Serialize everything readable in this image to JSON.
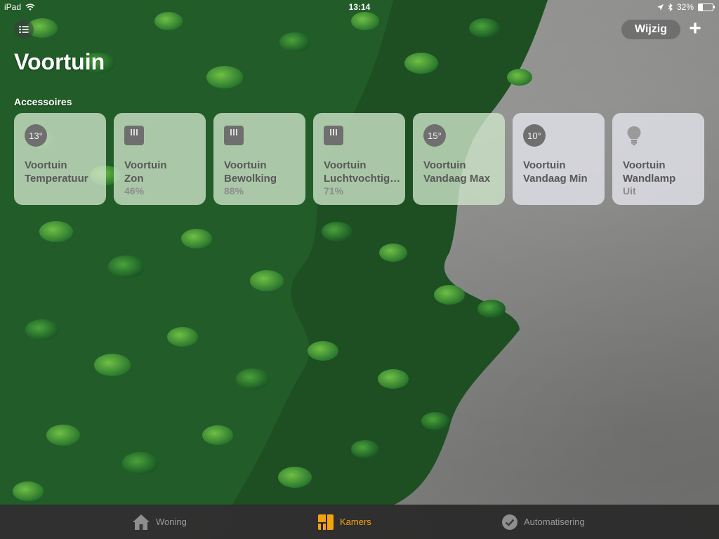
{
  "status_bar": {
    "device": "iPad",
    "time": "13:14",
    "battery": "32%",
    "battery_level": 0.32
  },
  "header": {
    "title": "Voortuin",
    "edit_label": "Wijzig",
    "add_label": "+"
  },
  "section": {
    "label": "Accessoires"
  },
  "tiles": [
    {
      "icon": "thermometer-value-icon",
      "icon_text": "13°",
      "line1": "Voortuin",
      "line2": "Temperatuur",
      "status": ""
    },
    {
      "icon": "sensor-icon",
      "icon_text": "",
      "line1": "Voortuin",
      "line2": "Zon",
      "status": "46%"
    },
    {
      "icon": "sensor-icon",
      "icon_text": "",
      "line1": "Voortuin",
      "line2": "Bewolking",
      "status": "88%"
    },
    {
      "icon": "sensor-icon",
      "icon_text": "",
      "line1": "Voortuin",
      "line2": "Luchtvochtigheid",
      "status": "71%"
    },
    {
      "icon": "thermometer-value-icon",
      "icon_text": "15°",
      "line1": "Voortuin",
      "line2": "Vandaag Max",
      "status": ""
    },
    {
      "icon": "thermometer-value-icon",
      "icon_text": "10°",
      "line1": "Voortuin",
      "line2": "Vandaag Min",
      "status": ""
    },
    {
      "icon": "lightbulb-icon",
      "icon_text": "",
      "line1": "Voortuin",
      "line2": "Wandlamp",
      "status": "Uit"
    }
  ],
  "tab_bar": {
    "tabs": [
      {
        "label": "Woning",
        "icon": "house-icon",
        "active": false
      },
      {
        "label": "Kamers",
        "icon": "rooms-icon",
        "active": true
      },
      {
        "label": "Automatisering",
        "icon": "clock-check-icon",
        "active": false
      }
    ]
  },
  "colors": {
    "accent": "#f5a30c",
    "tile_text": "#585858",
    "tile_status": "#8c8c8c"
  }
}
